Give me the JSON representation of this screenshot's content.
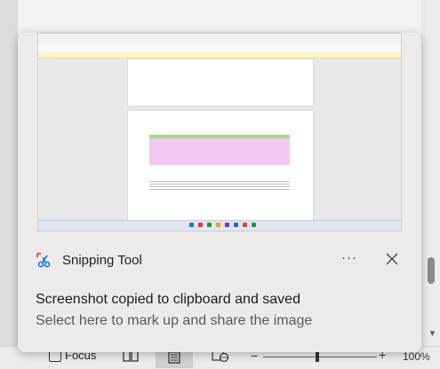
{
  "notification": {
    "app_name": "Snipping Tool",
    "more_label": "···",
    "title": "Screenshot copied to clipboard and saved",
    "subtitle": "Select here to mark up and share the image"
  },
  "statusbar": {
    "focus_label": "Focus",
    "zoom_label": "100%",
    "minus_label": "−",
    "plus_label": "+"
  },
  "colors": {
    "toast_bg": "#eeeae9",
    "accent_pink": "#f3c8f0",
    "accent_green": "#a8d88a"
  },
  "icons": {
    "app": "snipping-tool-icon",
    "close": "close-icon",
    "more": "more-options-icon"
  }
}
